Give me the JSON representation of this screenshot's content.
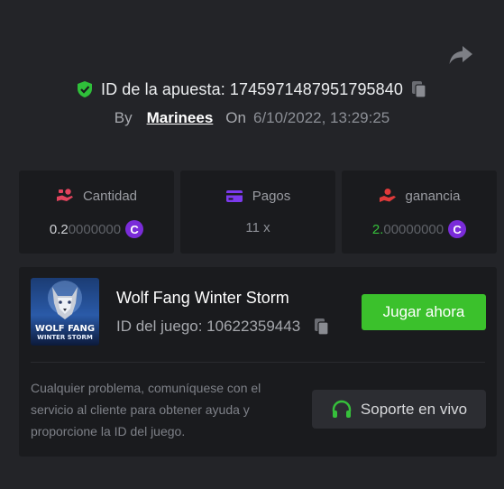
{
  "header": {
    "bet_id_label": "ID de la apuesta: 1745971487951795840",
    "by_label": "By",
    "username": "Marinees",
    "on_label": "On",
    "date": "6/10/2022, 13:29:25"
  },
  "icons": {
    "share": "share-arrow-icon",
    "verified": "shield-check-icon",
    "copy": "copy-icon"
  },
  "stats": {
    "amount": {
      "label": "Cantidad",
      "value_bright": "0.2",
      "value_dim": "0000000",
      "coin": "C"
    },
    "payout": {
      "label": "Pagos",
      "value": "11 x"
    },
    "profit": {
      "label": "ganancia",
      "value_bright": "2.",
      "value_dim": "00000000",
      "coin": "C"
    }
  },
  "game": {
    "thumbnail_line1": "WOLF FANG",
    "thumbnail_line2": "WINTER STORM",
    "title": "Wolf Fang Winter Storm",
    "id_label": "ID del juego: 10622359443",
    "play_label": "Jugar ahora",
    "help_text": "Cualquier problema, comuníquese con el servicio al cliente para obtener ayuda y proporcione la ID del juego.",
    "support_label": "Soporte en vivo"
  },
  "colors": {
    "background": "#232428",
    "card": "#1a1b1e",
    "accent_green": "#3bc12c",
    "coin_purple": "#7a2cd9",
    "shield_green": "#2fbf3a",
    "amount_icon_red": "#e2435d",
    "payout_icon_purple": "#7c3aed",
    "profit_icon_red": "#e03a3a"
  }
}
